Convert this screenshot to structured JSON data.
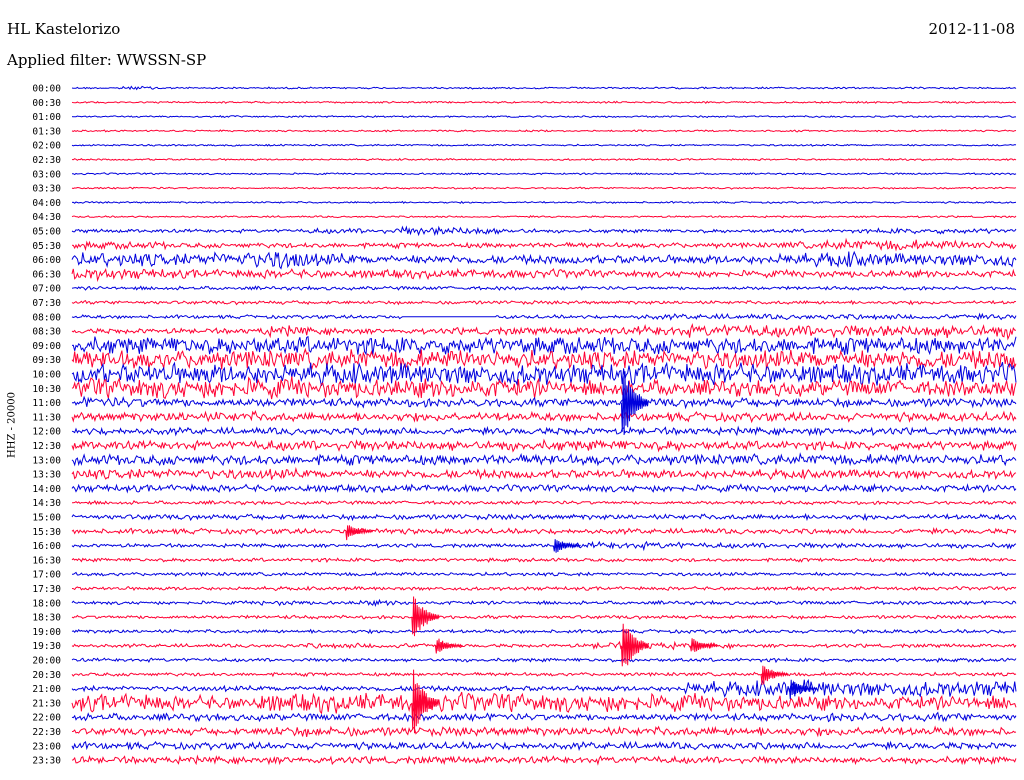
{
  "header": {
    "station": "HL Kastelorizo",
    "date": "2012-11-08",
    "filter": "Applied filter: WWSSN-SP"
  },
  "chart_data": {
    "type": "line",
    "title": "HL Kastelorizo",
    "subtitle": "Applied filter: WWSSN-SP",
    "ylabel": "HHZ - 20000",
    "xlabel": "",
    "colors": {
      "even_trace": "#0000dd",
      "odd_trace": "#ff0033"
    },
    "traces": [
      {
        "label": "00:00",
        "amp": [
          1,
          2,
          1,
          1,
          1,
          1,
          1,
          1,
          1,
          1,
          1,
          1,
          1,
          1,
          1,
          1,
          1,
          1,
          1,
          1
        ]
      },
      {
        "label": "00:30",
        "amp": [
          1,
          1,
          1,
          1,
          1,
          1,
          1,
          1,
          1,
          1,
          1,
          1,
          1,
          1,
          1,
          1,
          1,
          1,
          1,
          1
        ]
      },
      {
        "label": "01:00",
        "amp": [
          1,
          1,
          1,
          1,
          1,
          1,
          1,
          1,
          1,
          1,
          1,
          1,
          1,
          1,
          1,
          1,
          1,
          1,
          1,
          1
        ]
      },
      {
        "label": "01:30",
        "amp": [
          1,
          1,
          1,
          1,
          1,
          1,
          1,
          1,
          1,
          1,
          1,
          1,
          1,
          1,
          1,
          1,
          1,
          1,
          1,
          1
        ]
      },
      {
        "label": "02:00",
        "amp": [
          1,
          1,
          1,
          1,
          1,
          1,
          1,
          1,
          1,
          1,
          1,
          1,
          1,
          1,
          1,
          1,
          1,
          1,
          1,
          1
        ]
      },
      {
        "label": "02:30",
        "amp": [
          1,
          1,
          1,
          1,
          1,
          1,
          1,
          1,
          1,
          1,
          1,
          1,
          1,
          1,
          1,
          1,
          1,
          1,
          1,
          1
        ]
      },
      {
        "label": "03:00",
        "amp": [
          1,
          1,
          1,
          1,
          1,
          1,
          1,
          1,
          1,
          1,
          1,
          1,
          1,
          1,
          1,
          1,
          1,
          1,
          1,
          1
        ]
      },
      {
        "label": "03:30",
        "amp": [
          1,
          1,
          1,
          1,
          1,
          1,
          1,
          1,
          1,
          1,
          1,
          1,
          1,
          1,
          1,
          1,
          1,
          1,
          1,
          1
        ]
      },
      {
        "label": "04:00",
        "amp": [
          1,
          1,
          1,
          1,
          1,
          1,
          1,
          1,
          1,
          1,
          1,
          1,
          1,
          1,
          1,
          1,
          1,
          1,
          1,
          1
        ]
      },
      {
        "label": "04:30",
        "amp": [
          1,
          1,
          1,
          1,
          1,
          1,
          1,
          1,
          1,
          1,
          1,
          1,
          1,
          1,
          1,
          1,
          1,
          1,
          1,
          1
        ]
      },
      {
        "label": "05:00",
        "amp": [
          2,
          2,
          2,
          2,
          2,
          3,
          3,
          5,
          5,
          3,
          2,
          2,
          2,
          2,
          2,
          2,
          2,
          3,
          3,
          3
        ]
      },
      {
        "label": "05:30",
        "amp": [
          4,
          4,
          3,
          3,
          3,
          3,
          3,
          3,
          3,
          3,
          3,
          3,
          3,
          3,
          3,
          4,
          6,
          6,
          5,
          5
        ]
      },
      {
        "label": "06:00",
        "amp": [
          8,
          8,
          7,
          9,
          12,
          7,
          5,
          5,
          5,
          5,
          5,
          5,
          5,
          5,
          5,
          7,
          9,
          7,
          7,
          8
        ]
      },
      {
        "label": "06:30",
        "amp": [
          7,
          6,
          5,
          5,
          5,
          5,
          5,
          5,
          5,
          5,
          5,
          4,
          4,
          4,
          4,
          4,
          4,
          4,
          4,
          4
        ]
      },
      {
        "label": "07:00",
        "amp": [
          2,
          2,
          2,
          2,
          2,
          2,
          2,
          2,
          2,
          2,
          2,
          2,
          2,
          2,
          2,
          2,
          2,
          2,
          2,
          2
        ]
      },
      {
        "label": "07:30",
        "amp": [
          2,
          2,
          2,
          2,
          2,
          2,
          2,
          2,
          2,
          2,
          2,
          2,
          2,
          2,
          2,
          2,
          2,
          2,
          2,
          2
        ]
      },
      {
        "label": "08:00",
        "amp": [
          2,
          2,
          2,
          2,
          2,
          2,
          2,
          0,
          0,
          2,
          2,
          2,
          3,
          3,
          3,
          3,
          3,
          3,
          3,
          3
        ]
      },
      {
        "label": "08:30",
        "amp": [
          3,
          3,
          3,
          3,
          6,
          4,
          3,
          3,
          4,
          4,
          4,
          4,
          6,
          7,
          7,
          7,
          7,
          7,
          8,
          8
        ]
      },
      {
        "label": "09:00",
        "amp": [
          10,
          10,
          10,
          10,
          10,
          10,
          10,
          10,
          10,
          10,
          10,
          10,
          10,
          10,
          10,
          10,
          10,
          10,
          10,
          10
        ]
      },
      {
        "label": "09:30",
        "amp": [
          11,
          11,
          11,
          11,
          11,
          11,
          11,
          11,
          11,
          11,
          11,
          11,
          11,
          11,
          11,
          11,
          11,
          11,
          11,
          11
        ]
      },
      {
        "label": "10:00",
        "amp": [
          12,
          12,
          12,
          12,
          12,
          12,
          12,
          12,
          12,
          12,
          12,
          12,
          12,
          12,
          12,
          12,
          12,
          12,
          12,
          12
        ]
      },
      {
        "label": "10:30",
        "amp": [
          12,
          12,
          12,
          12,
          12,
          11,
          11,
          11,
          11,
          11,
          9,
          9,
          9,
          9,
          9,
          9,
          9,
          9,
          9,
          9
        ]
      },
      {
        "label": "11:00",
        "amp": [
          6,
          6,
          5,
          5,
          5,
          5,
          5,
          5,
          5,
          5,
          5,
          5,
          5,
          5,
          5,
          5,
          5,
          5,
          5,
          5
        ]
      },
      {
        "label": "11:30",
        "amp": [
          5,
          5,
          6,
          6,
          5,
          5,
          5,
          5,
          5,
          5,
          5,
          5,
          5,
          5,
          5,
          5,
          5,
          5,
          5,
          5
        ]
      },
      {
        "label": "12:00",
        "amp": [
          4,
          4,
          4,
          4,
          4,
          4,
          4,
          4,
          4,
          4,
          4,
          4,
          4,
          4,
          4,
          4,
          4,
          4,
          4,
          4
        ]
      },
      {
        "label": "12:30",
        "amp": [
          5,
          5,
          5,
          5,
          6,
          6,
          6,
          6,
          6,
          6,
          6,
          6,
          6,
          5,
          5,
          5,
          5,
          5,
          5,
          5
        ]
      },
      {
        "label": "13:00",
        "amp": [
          6,
          6,
          6,
          6,
          6,
          6,
          6,
          6,
          6,
          6,
          6,
          6,
          6,
          6,
          6,
          6,
          6,
          6,
          6,
          6
        ]
      },
      {
        "label": "13:30",
        "amp": [
          6,
          6,
          6,
          6,
          6,
          5,
          5,
          5,
          5,
          5,
          5,
          5,
          5,
          5,
          5,
          5,
          5,
          5,
          5,
          5
        ]
      },
      {
        "label": "14:00",
        "amp": [
          4,
          4,
          4,
          4,
          4,
          4,
          4,
          4,
          4,
          4,
          4,
          4,
          4,
          4,
          4,
          4,
          4,
          4,
          4,
          4
        ]
      },
      {
        "label": "14:30",
        "amp": [
          2,
          2,
          2,
          2,
          2,
          2,
          2,
          2,
          2,
          2,
          2,
          2,
          2,
          2,
          2,
          2,
          2,
          2,
          2,
          2
        ]
      },
      {
        "label": "15:00",
        "amp": [
          3,
          3,
          3,
          3,
          3,
          3,
          3,
          3,
          3,
          3,
          3,
          3,
          3,
          3,
          3,
          3,
          3,
          3,
          3,
          3
        ]
      },
      {
        "label": "15:30",
        "amp": [
          3,
          3,
          3,
          3,
          3,
          3,
          4,
          3,
          3,
          3,
          3,
          3,
          3,
          3,
          3,
          3,
          3,
          3,
          3,
          3
        ]
      },
      {
        "label": "16:00",
        "amp": [
          2,
          2,
          2,
          2,
          2,
          2,
          2,
          2,
          2,
          2,
          3,
          4,
          4,
          3,
          3,
          3,
          3,
          3,
          3,
          3
        ]
      },
      {
        "label": "16:30",
        "amp": [
          2,
          2,
          2,
          2,
          2,
          2,
          2,
          2,
          2,
          2,
          2,
          2,
          2,
          2,
          2,
          2,
          2,
          2,
          2,
          2
        ]
      },
      {
        "label": "17:00",
        "amp": [
          2,
          2,
          2,
          2,
          2,
          2,
          2,
          2,
          2,
          2,
          2,
          2,
          2,
          2,
          2,
          2,
          2,
          2,
          2,
          2
        ]
      },
      {
        "label": "17:30",
        "amp": [
          2,
          2,
          2,
          2,
          2,
          2,
          2,
          2,
          2,
          2,
          2,
          2,
          2,
          2,
          2,
          2,
          2,
          2,
          2,
          2
        ]
      },
      {
        "label": "18:00",
        "amp": [
          2,
          2,
          2,
          2,
          3,
          2,
          3,
          2,
          2,
          2,
          2,
          2,
          2,
          2,
          2,
          2,
          2,
          2,
          2,
          2
        ]
      },
      {
        "label": "18:30",
        "amp": [
          2,
          2,
          2,
          2,
          2,
          2,
          2,
          2,
          2,
          2,
          2,
          2,
          2,
          2,
          2,
          2,
          2,
          2,
          2,
          2
        ]
      },
      {
        "label": "19:00",
        "amp": [
          2,
          2,
          2,
          2,
          2,
          2,
          2,
          2,
          2,
          2,
          2,
          2,
          2,
          2,
          2,
          2,
          2,
          2,
          2,
          2
        ]
      },
      {
        "label": "19:30",
        "amp": [
          2,
          2,
          2,
          2,
          2,
          3,
          3,
          3,
          2,
          2,
          2,
          4,
          4,
          3,
          2,
          2,
          2,
          2,
          2,
          2
        ]
      },
      {
        "label": "20:00",
        "amp": [
          2,
          2,
          2,
          2,
          2,
          2,
          2,
          2,
          2,
          2,
          2,
          2,
          2,
          2,
          2,
          2,
          2,
          2,
          2,
          2
        ]
      },
      {
        "label": "20:30",
        "amp": [
          2,
          2,
          2,
          2,
          2,
          2,
          2,
          2,
          2,
          2,
          2,
          2,
          2,
          2,
          2,
          2,
          2,
          2,
          2,
          2
        ]
      },
      {
        "label": "21:00",
        "amp": [
          3,
          3,
          3,
          3,
          3,
          3,
          3,
          3,
          3,
          3,
          3,
          3,
          3,
          8,
          9,
          10,
          9,
          9,
          9,
          9
        ]
      },
      {
        "label": "21:30",
        "amp": [
          10,
          10,
          8,
          8,
          11,
          11,
          11,
          11,
          11,
          11,
          11,
          11,
          10,
          10,
          9,
          9,
          8,
          8,
          8,
          8
        ]
      },
      {
        "label": "22:00",
        "amp": [
          4,
          4,
          4,
          4,
          4,
          4,
          4,
          4,
          4,
          4,
          4,
          4,
          4,
          4,
          4,
          4,
          5,
          5,
          5,
          4
        ]
      },
      {
        "label": "22:30",
        "amp": [
          4,
          4,
          4,
          4,
          6,
          6,
          5,
          5,
          5,
          5,
          5,
          5,
          5,
          5,
          5,
          5,
          5,
          5,
          5,
          5
        ]
      },
      {
        "label": "23:00",
        "amp": [
          4,
          4,
          4,
          4,
          4,
          4,
          4,
          4,
          4,
          4,
          4,
          4,
          4,
          4,
          4,
          4,
          4,
          4,
          4,
          4
        ]
      },
      {
        "label": "23:30",
        "amp": [
          4,
          4,
          4,
          4,
          4,
          4,
          4,
          4,
          4,
          4,
          4,
          4,
          4,
          4,
          4,
          4,
          4,
          4,
          4,
          4
        ]
      }
    ],
    "events": [
      {
        "trace": "18:30",
        "x_fraction": 0.36,
        "amp": 30
      },
      {
        "trace": "21:30",
        "x_fraction": 0.36,
        "amp": 40
      },
      {
        "trace": "19:30",
        "x_fraction": 0.582,
        "amp": 35
      },
      {
        "trace": "11:00",
        "x_fraction": 0.582,
        "amp": 45
      },
      {
        "trace": "15:30",
        "x_fraction": 0.29,
        "amp": 10
      },
      {
        "trace": "16:00",
        "x_fraction": 0.51,
        "amp": 10
      },
      {
        "trace": "19:30",
        "x_fraction": 0.385,
        "amp": 10
      },
      {
        "trace": "19:30",
        "x_fraction": 0.655,
        "amp": 10
      },
      {
        "trace": "20:30",
        "x_fraction": 0.73,
        "amp": 14
      },
      {
        "trace": "21:00",
        "x_fraction": 0.76,
        "amp": 12
      }
    ]
  }
}
